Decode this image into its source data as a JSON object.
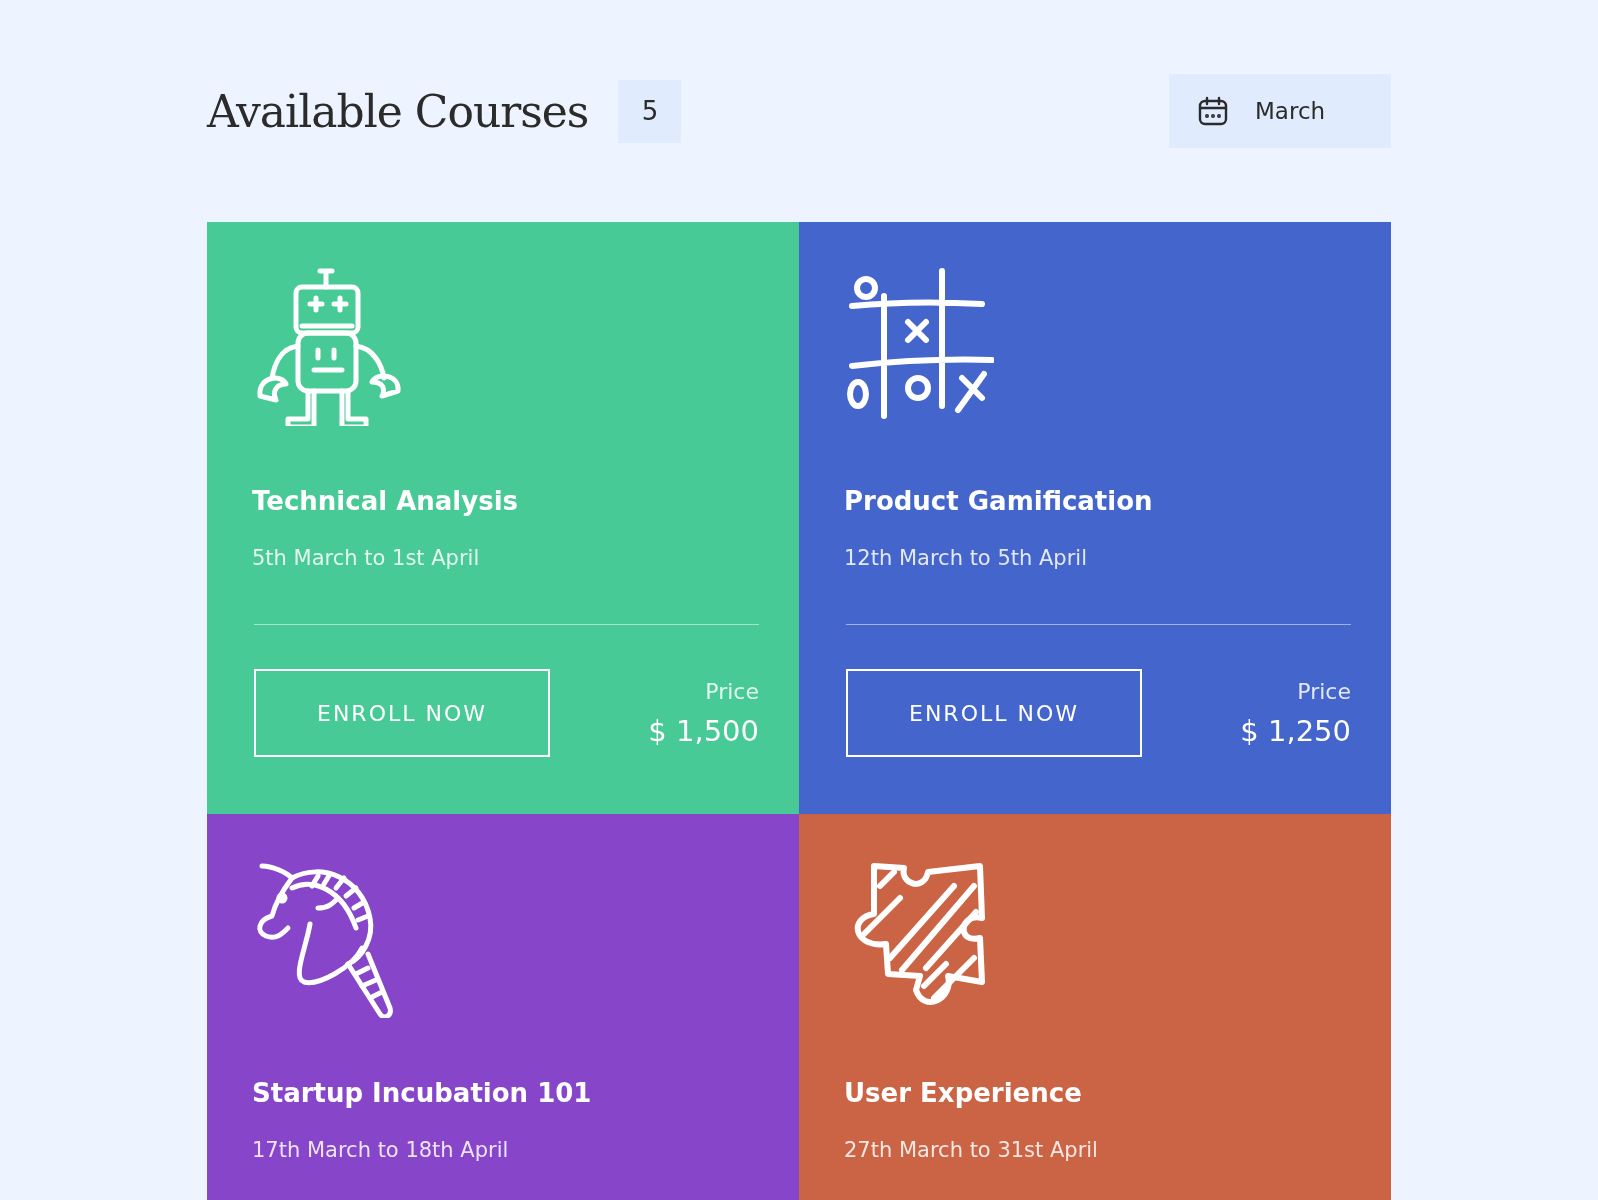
{
  "header": {
    "title": "Available Courses",
    "count": "5",
    "month_button": {
      "label": "March"
    }
  },
  "courses": [
    {
      "kind": "robot",
      "color": "#47ca95",
      "title": "Technical Analysis",
      "dates": "5th March to 1st April",
      "button": "ENROLL NOW",
      "price_label": "Price",
      "price": "$ 1,500"
    },
    {
      "kind": "tictactoe",
      "color": "#4465cb",
      "title": "Product Gamification",
      "dates": "12th March to 5th April",
      "button": "ENROLL NOW",
      "price_label": "Price",
      "price": "$ 1,250"
    },
    {
      "kind": "horse",
      "color": "#8745c9",
      "title": "Startup Incubation 101",
      "dates": "17th March to 18th April"
    },
    {
      "kind": "puzzle",
      "color": "#cb6444",
      "title": "User Experience",
      "dates": "27th March to 31st April"
    }
  ]
}
